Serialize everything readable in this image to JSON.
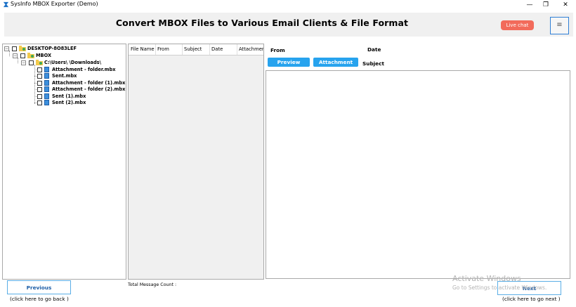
{
  "window": {
    "title": "SysInfo MBOX Exporter (Demo)",
    "minimize_icon": "minimize-icon",
    "maximize_icon": "maximize-icon",
    "close_icon": "close-icon",
    "minimize_glyph": "—",
    "maximize_glyph": "❐",
    "close_glyph": "✕"
  },
  "header": {
    "title": "Convert MBOX Files to Various Email Clients & File Format",
    "live_chat_label": "Live chat",
    "menu_glyph": "≡",
    "accent_color": "#f26b5b"
  },
  "tree": {
    "root": {
      "label": "DESKTOP-8O83LEF",
      "expander": "−"
    },
    "mbox": {
      "label": "MBOX",
      "expander": "−"
    },
    "path": {
      "label": "C:\\Users\\        \\Downloads\\",
      "expander": "−"
    },
    "files": [
      {
        "label": "Attachment - folder.mbx"
      },
      {
        "label": "Sent.mbx"
      },
      {
        "label": "Attachment - folder (1).mbx"
      },
      {
        "label": "Attachment - folder (2).mbx"
      },
      {
        "label": "Sent (1).mbx"
      },
      {
        "label": "Sent (2).mbx"
      }
    ]
  },
  "list": {
    "columns": [
      "File Name",
      "From",
      "Subject",
      "Date",
      "Attachment"
    ]
  },
  "preview": {
    "from_label": "From",
    "date_label": "Date",
    "subject_label": "Subject",
    "preview_button": "Preview",
    "attachment_button": "Attachment",
    "button_color": "#27a3ee"
  },
  "footer": {
    "previous_label": "Previous",
    "previous_hint": "(click here to  go back )",
    "total_count_label": "Total Message Count :",
    "next_label": "Next",
    "next_hint": "(click here to  go next )"
  },
  "watermark": {
    "title": "Activate Windows",
    "subtitle": "Go to Settings to activate Windows."
  }
}
